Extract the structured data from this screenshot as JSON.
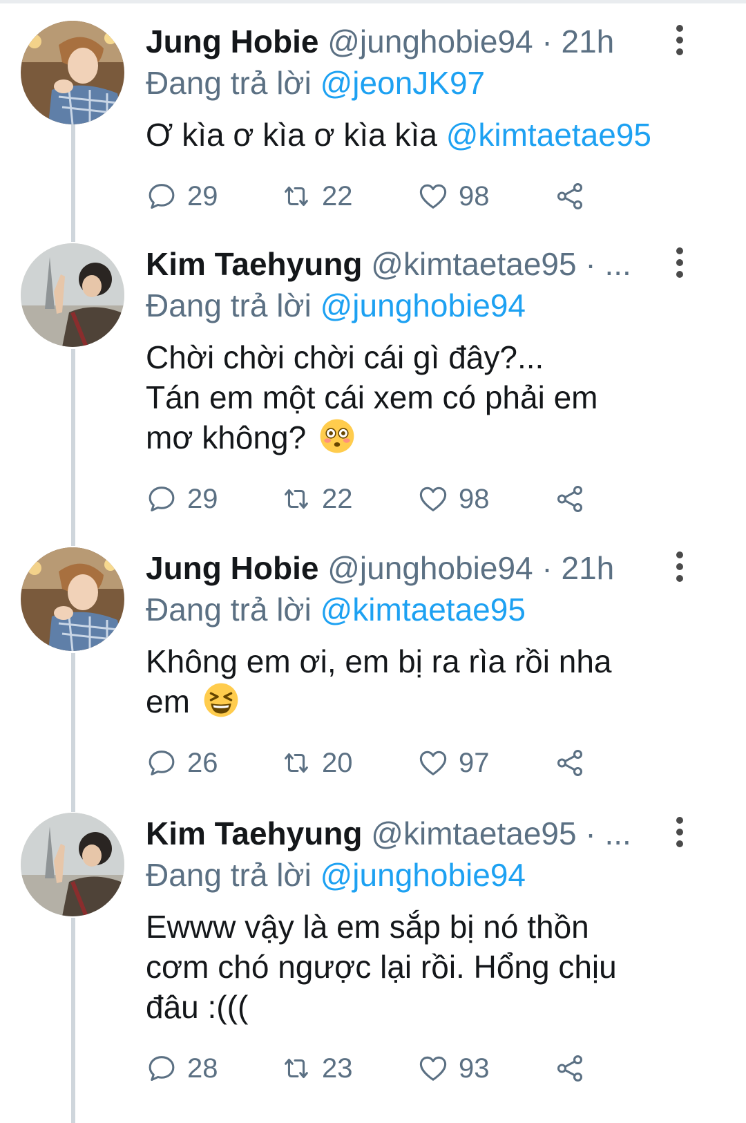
{
  "replying_prefix": "Đang trả lời",
  "tweets": [
    {
      "name": "Jung Hobie",
      "handle": "@junghobie94",
      "separator": "·",
      "time": "21h",
      "reply_to": "@jeonJK97",
      "body_line1": "Ơ kìa ơ kìa ơ kìa kìa ",
      "body_mention": "@kimtaetae95",
      "reply_count": "29",
      "retweet_count": "22",
      "like_count": "98"
    },
    {
      "name": "Kim Taehyung",
      "handle": "@kimtaetae95",
      "separator": "·",
      "time": "...",
      "reply_to": "@junghobie94",
      "body_line1": "Chời chời chời cái gì đây?...",
      "body_line2": "Tán em một cái xem có phải em",
      "body_line3": "mơ không? ",
      "emoji": "flushed-face-emoji",
      "reply_count": "29",
      "retweet_count": "22",
      "like_count": "98"
    },
    {
      "name": "Jung Hobie",
      "handle": "@junghobie94",
      "separator": "·",
      "time": "21h",
      "reply_to": "@kimtaetae95",
      "body_line1": "Không em ơi, em bị ra rìa rồi nha",
      "body_line2": "em ",
      "emoji": "laughing-squint-emoji",
      "reply_count": "26",
      "retweet_count": "20",
      "like_count": "97"
    },
    {
      "name": "Kim Taehyung",
      "handle": "@kimtaetae95",
      "separator": "·",
      "time": "...",
      "reply_to": "@junghobie94",
      "body_line1": "Ewww vậy là em sắp bị nó thồn",
      "body_line2": "cơm chó ngược lại rồi. Hổng chịu",
      "body_line3": "đâu :(((",
      "reply_count": "28",
      "retweet_count": "23",
      "like_count": "93"
    }
  ],
  "icons": {
    "reply": "reply-bubble-icon",
    "retweet": "retweet-icon",
    "like": "heart-icon",
    "share": "share-icon",
    "more": "more-vertical-icon"
  },
  "colors": {
    "mention": "#1da1f2",
    "secondary_text": "#5b7083",
    "thread_line": "#cfd6dc"
  }
}
